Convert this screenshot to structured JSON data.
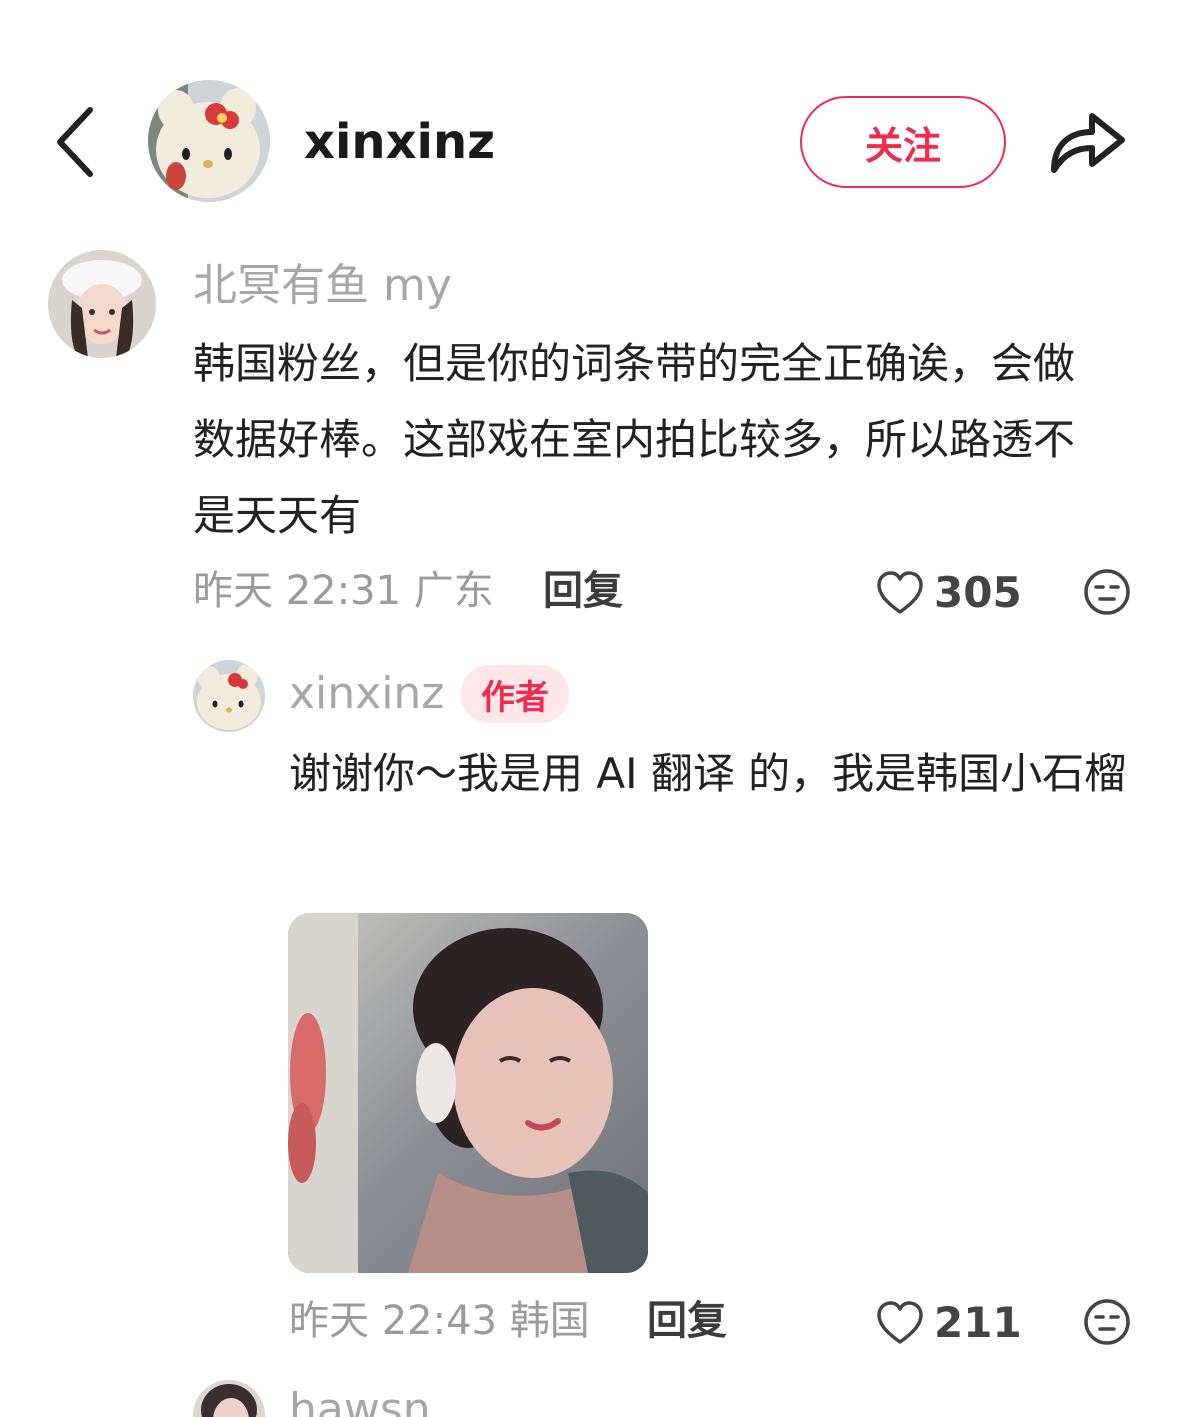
{
  "header": {
    "back_icon": "chevron-left-icon",
    "username": "xinxinz",
    "follow_label": "关注",
    "share_icon": "share-arrow-icon",
    "accent_color": "#ef2c4f"
  },
  "comments": [
    {
      "username": "北冥有鱼 my",
      "text": "韩国粉丝，但是你的词条带的完全正确诶，会做数据好棒。这部戏在室内拍比较多，所以路透不是天天有",
      "time_location": "昨天 22:31 广东",
      "reply_label": "回复",
      "likes": "305",
      "reply": {
        "username": "xinxinz",
        "badge": "作者",
        "text": "谢谢你～我是用 AI 翻译 的，我是韩国小石榴",
        "has_image": true,
        "time_location": "昨天 22:43 韩国",
        "reply_label": "回复",
        "likes": "211"
      }
    }
  ],
  "next_comment": {
    "username_partial": "hawsn"
  }
}
